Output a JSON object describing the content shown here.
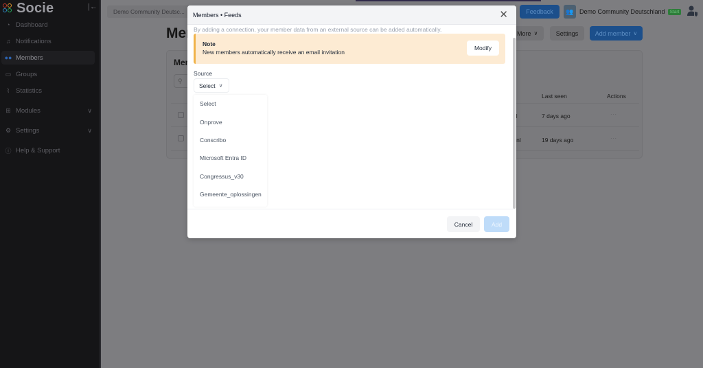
{
  "sidebar": {
    "brand": "Socie",
    "collapse_icon": "collapse-left-icon",
    "items": [
      {
        "label": "Dashboard",
        "icon": "dashboard-icon",
        "active": false
      },
      {
        "label": "Notifications",
        "icon": "bell-icon",
        "active": false
      },
      {
        "label": "Members",
        "icon": "users-icon",
        "active": true
      },
      {
        "label": "Groups",
        "icon": "groups-icon",
        "active": false
      },
      {
        "label": "Statistics",
        "icon": "chart-icon",
        "active": false
      },
      {
        "label": "Modules",
        "icon": "grid-icon",
        "active": false,
        "expandable": true
      },
      {
        "label": "Settings",
        "icon": "gear-icon",
        "active": false,
        "expandable": true
      },
      {
        "label": "Help & Support",
        "icon": "help-icon",
        "active": false
      }
    ]
  },
  "topbar": {
    "community_crumb": "Demo Community Deutsc...",
    "feedback_label": "Feedback",
    "community_name": "Demo Community Deutschland",
    "plan_badge": "Start"
  },
  "page": {
    "title": "Members",
    "more_label": "More",
    "settings_label": "Settings",
    "add_member_label": "Add member",
    "panel_title": "Members",
    "table": {
      "headers": {
        "col_partial": "s",
        "last_seen": "Last seen",
        "actions": "Actions"
      },
      "rows": [
        {
          "email_partial": "nl",
          "last_seen": "7 days ago",
          "actions": "···"
        },
        {
          "email_partial": "e.nl",
          "last_seen": "19 days ago",
          "actions": "···"
        }
      ]
    }
  },
  "modal": {
    "title": "Members • Feeds",
    "description": "By adding a connection, your member data from an external source can be added automatically.",
    "note": {
      "title": "Note",
      "text": "New members automatically receive an email invitation",
      "modify_label": "Modify"
    },
    "source_label": "Source",
    "source_selected": "Select",
    "source_options": [
      "Select",
      "Onprove",
      "Conscribo",
      "Microsoft Entra ID",
      "Congressus_v30",
      "Gemeente_oplossingen"
    ],
    "cancel_label": "Cancel",
    "add_label": "Add"
  },
  "colors": {
    "primary": "#3b82f6",
    "note_bg": "#fdebd3",
    "note_border": "#f0b34a",
    "badge_green": "#2e7d3a"
  }
}
